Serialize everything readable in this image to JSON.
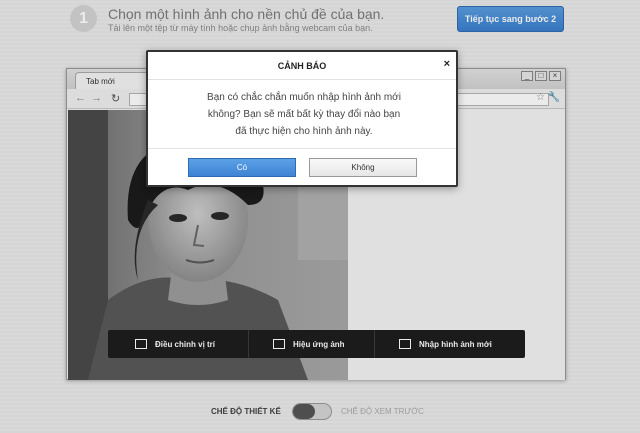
{
  "step": {
    "number": "1",
    "title": "Chọn một hình ảnh cho nền chủ đề của bạn.",
    "subtitle": "Tải lên một tệp từ máy tính hoặc chụp ảnh bằng webcam của bạn.",
    "continue_label": "Tiếp tục sang bước 2"
  },
  "browser": {
    "tab_label": "Tab mới",
    "controls": [
      "minimize-icon",
      "maximize-icon",
      "close-icon"
    ],
    "nav_icons": [
      "back-icon",
      "forward-icon",
      "reload-icon",
      "bookmark-star-icon",
      "wrench-icon"
    ]
  },
  "actions": [
    {
      "label": "Điều chỉnh vị trí",
      "icon": "crop-icon"
    },
    {
      "label": "Hiệu ứng ảnh",
      "icon": "image-icon"
    },
    {
      "label": "Nhập hình ảnh mới",
      "icon": "import-icon"
    }
  ],
  "mode": {
    "design_label": "CHẾ ĐỘ THIẾT KẾ",
    "preview_label": "CHẾ ĐỘ XEM TRƯỚC"
  },
  "dialog": {
    "title": "CẢNH BÁO",
    "close": "×",
    "message_line1": "Bạn có chắc chắn muốn nhập hình ảnh mới",
    "message_line2": "không? Bạn sẽ mất bất kỳ thay đổi nào bạn",
    "message_line3": "đã thực hiện cho hình ảnh này.",
    "yes_label": "Có",
    "no_label": "Không"
  },
  "colors": {
    "primary_blue": "#3d83d3",
    "action_bar": "#1e1e1e"
  }
}
